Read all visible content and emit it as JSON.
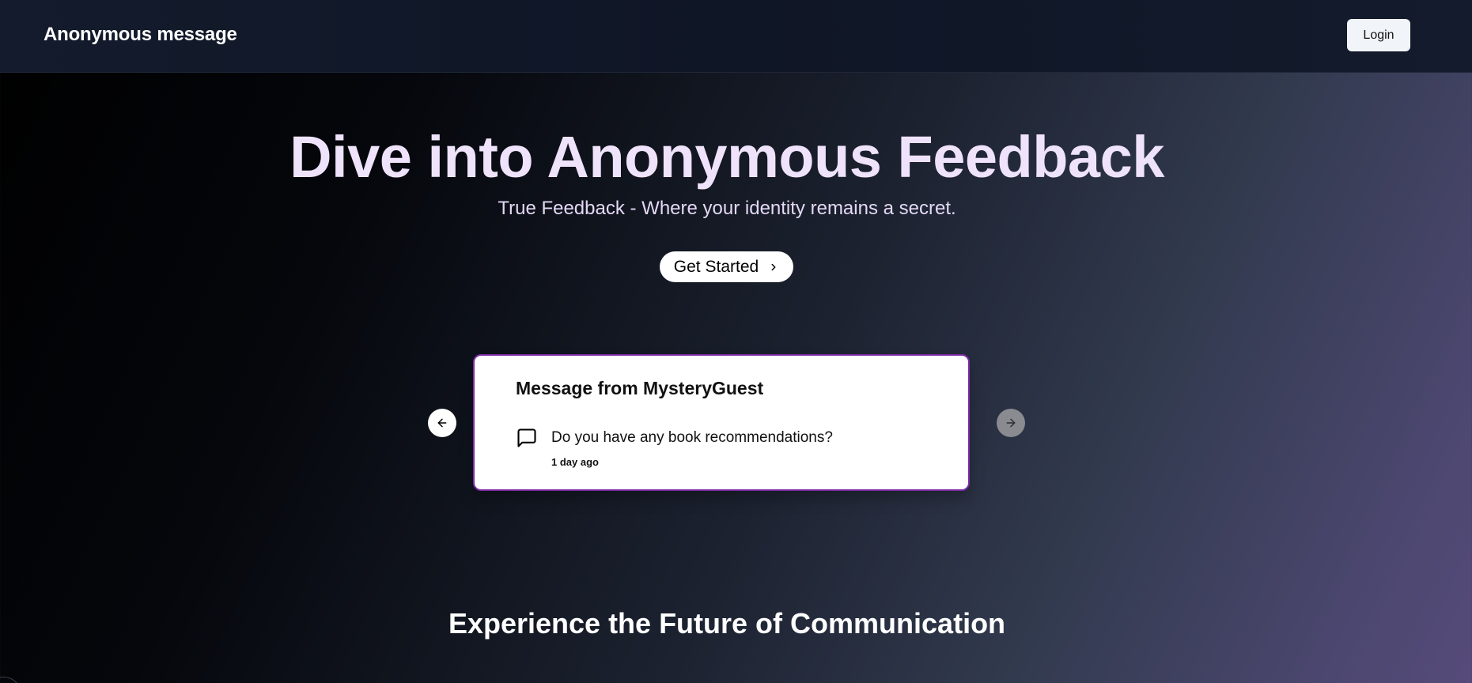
{
  "navbar": {
    "brand": "Anonymous message",
    "login_label": "Login"
  },
  "hero": {
    "title": "Dive into Anonymous Feedback",
    "subtitle": "True Feedback - Where your identity remains a secret.",
    "cta_label": "Get Started",
    "cta_icon": "chevron-right-icon"
  },
  "carousel": {
    "prev_icon": "arrow-left-icon",
    "next_icon": "arrow-right-icon",
    "message": {
      "title": "Message from MysteryGuest",
      "icon": "message-square-icon",
      "content": "Do you have any book recommendations?",
      "received": "1 day ago"
    }
  },
  "features": {
    "title": "Experience the Future of Communication"
  },
  "colors": {
    "hero_text": "#efe3fb",
    "card_border": "#7b2aa3",
    "navbar_bg": "#111827"
  }
}
